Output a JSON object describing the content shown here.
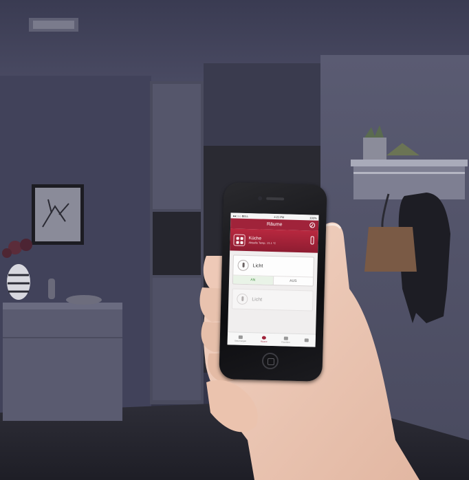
{
  "phone_app": {
    "status": {
      "carrier": "●●○○○ BELL",
      "time": "4:21 PM",
      "battery": "100%"
    },
    "nav_title": "Räume",
    "room": {
      "name": "Küche",
      "temperature_line": "Aktuelle Temp.: 21.1 °C"
    },
    "device_cards": [
      {
        "label": "Licht",
        "on_label": "AN",
        "off_label": "AUS",
        "state": "AN"
      },
      {
        "label": "Licht"
      }
    ],
    "tabs": [
      {
        "label": "Steuerungen",
        "icon": "sliders-icon"
      },
      {
        "label": "Räume",
        "icon": "rooms-icon",
        "active": true
      },
      {
        "label": "Favoriten",
        "icon": "house-icon"
      },
      {
        "label": "",
        "icon": "menu-icon"
      }
    ]
  },
  "colors": {
    "accent": "#a0233a",
    "room_bg": "#35364a",
    "wall": "#4a4b64"
  }
}
